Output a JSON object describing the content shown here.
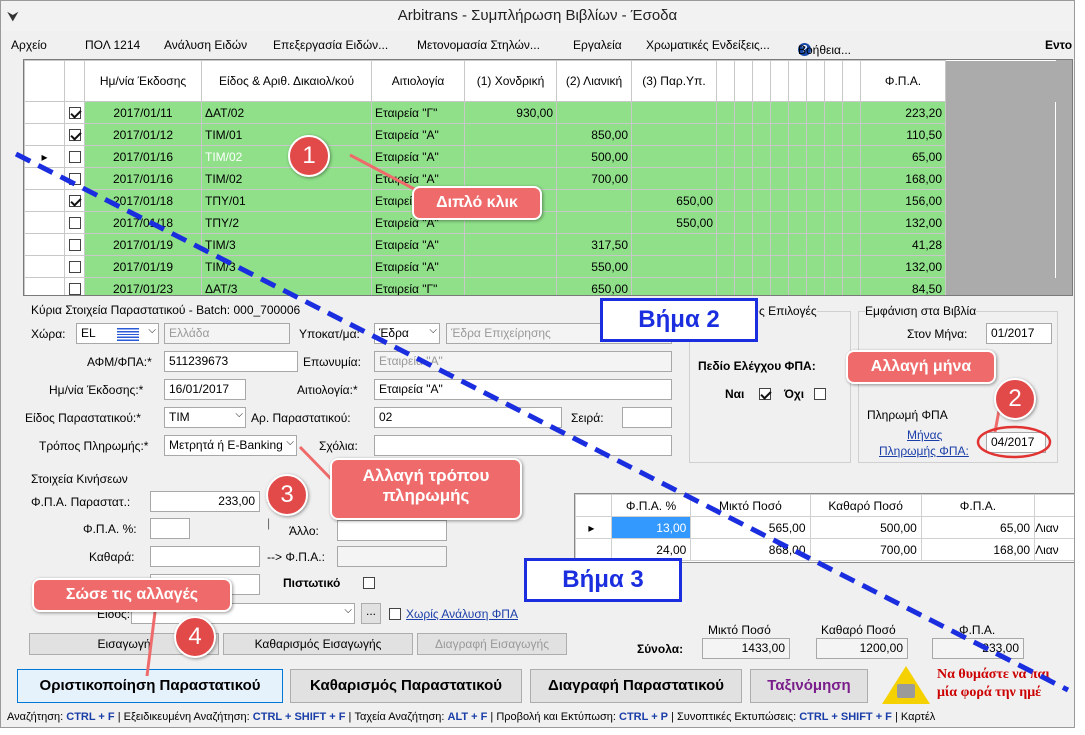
{
  "window": {
    "title": "Arbitrans - Συμπλήρωση Βιβλίων - Έσοδα",
    "icon": "arbitrans-logo-icon"
  },
  "menu": [
    "Αρχείο",
    "ΠΟΛ 1214",
    "Ανάλυση Ειδών",
    "Επεξεργασία Ειδών...",
    "Μετονομασία Στηλών...",
    "Εργαλεία",
    "Χρωματικές Ενδείξεις...",
    "Βοήθεια...",
    "Εντο"
  ],
  "grid": {
    "headers": [
      "Ημ/νία Έκδοσης",
      "Είδος & Αριθ. Δικαιολ/κού",
      "Αιτιολογία",
      "(1) Χονδρική",
      "(2) Λιανική",
      "(3) Παρ.Υπ.",
      "Φ.Π.Α."
    ],
    "rows": [
      {
        "checked": true,
        "date": "2017/01/11",
        "doc": "ΔΑΤ/02",
        "reason": "Εταιρεία \"Γ\"",
        "c1": "930,00",
        "c2": "",
        "c3": "",
        "vat": "223,20"
      },
      {
        "checked": true,
        "date": "2017/01/12",
        "doc": "ΤΙΜ/01",
        "reason": "Εταιρεία \"Α\"",
        "c1": "",
        "c2": "850,00",
        "c3": "",
        "vat": "110,50"
      },
      {
        "checked": false,
        "date": "2017/01/16",
        "doc": "ΤΙΜ/02",
        "reason": "Εταιρεία \"Α\"",
        "c1": "",
        "c2": "500,00",
        "c3": "",
        "vat": "65,00"
      },
      {
        "checked": false,
        "date": "2017/01/16",
        "doc": "ΤΙΜ/02",
        "reason": "Εταιρεία \"Α\"",
        "c1": "",
        "c2": "700,00",
        "c3": "",
        "vat": "168,00"
      },
      {
        "checked": true,
        "date": "2017/01/18",
        "doc": "ΤΠΥ/01",
        "reason": "Εταιρεία \"Α\"",
        "c1": "",
        "c2": "",
        "c3": "650,00",
        "vat": "156,00"
      },
      {
        "checked": false,
        "date": "2017/01/18",
        "doc": "ΤΠΥ/2",
        "reason": "Εταιρεία \"Α\"",
        "c1": "",
        "c2": "",
        "c3": "550,00",
        "vat": "132,00"
      },
      {
        "checked": false,
        "date": "2017/01/19",
        "doc": "ΤΙΜ/3",
        "reason": "Εταιρεία \"Α\"",
        "c1": "",
        "c2": "317,50",
        "c3": "",
        "vat": "41,28"
      },
      {
        "checked": false,
        "date": "2017/01/19",
        "doc": "ΤΙΜ/3",
        "reason": "Εταιρεία \"Α\"",
        "c1": "",
        "c2": "550,00",
        "c3": "",
        "vat": "132,00"
      },
      {
        "checked": false,
        "date": "2017/01/23",
        "doc": "ΔΑΤ/3",
        "reason": "Εταιρεία \"Γ\"",
        "c1": "",
        "c2": "650,00",
        "c3": "",
        "vat": "84,50"
      }
    ]
  },
  "main": {
    "title": "Κύρια Στοιχεία Παραστατικού - Batch: 000_700006",
    "country_label": "Χώρα:",
    "country_code": "EL",
    "country_name": "Ελλάδα",
    "branch_label": "Υποκατ/μα:",
    "branch_value": "Έδρα",
    "branch_name": "Έδρα Επιχείρησης",
    "afm_label": "ΑΦΜ/ΦΠΑ:*",
    "afm_value": "511239673",
    "name_label": "Επωνυμία:",
    "name_value": "Εταιρεία \"Α\"",
    "date_label": "Ημ/νία Έκδοσης:*",
    "date_value": "16/01/2017",
    "reason_label": "Αιτιολογία:*",
    "reason_value": "Εταιρεία \"Α\"",
    "type_label": "Είδος Παραστατικού:*",
    "type_value": "ΤΙΜ",
    "num_label": "Αρ. Παραστατικού:",
    "num_value": "02",
    "series_label": "Σειρά:",
    "series_value": "",
    "pay_label": "Τρόπος Πληρωμής:*",
    "pay_value": "Μετρητά ή E-Banking",
    "notes_label": "Σχόλια:",
    "notes_value": ""
  },
  "options": {
    "title": "ς Επιλογές",
    "vat_check_label": "Πεδίο Ελέγχου ΦΠΑ:",
    "yes": "Ναι",
    "no": "Όχι",
    "yes_checked": true,
    "no_checked": false
  },
  "books": {
    "title": "Εμφάνιση στα Βιβλία",
    "month_label": "Στον Μήνα:",
    "month_value": "01/2017",
    "vat_title": "Πληρωμή ΦΠΑ",
    "vat_link1": "Μήνας",
    "vat_link2": "Πληρωμής ΦΠΑ:",
    "vat_month": "04/2017"
  },
  "moves": {
    "title": "Στοιχεία Κινήσεων",
    "vat_doc_label": "Φ.Π.Α. Παραστατ.:",
    "vat_doc_value": "233,00",
    "e_mark": "€",
    "vat_pct_label": "Φ.Π.Α. %:",
    "net_label": "Καθαρά:",
    "other_label": "Άλλο:",
    "arrow_vat_label": "--> Φ.Π.Α.:",
    "credit_label": "Πιστωτικό",
    "item_label": "Είδος:",
    "no_analysis": "Χωρίς Ανάλυση ΦΠΑ",
    "btn_insert": "Εισαγωγή",
    "btn_clear_insert": "Καθαρισμός Εισαγωγής",
    "btn_delete_insert": "Διαγραφή Εισαγωγής"
  },
  "vat_grid": {
    "headers": [
      "Φ.Π.Α. %",
      "Μικτό Ποσό",
      "Καθαρό Ποσό",
      "Φ.Π.Α."
    ],
    "rows": [
      [
        "13,00",
        "565,00",
        "500,00",
        "65,00",
        "Λιαν"
      ],
      [
        "24,00",
        "868,00",
        "700,00",
        "168,00",
        "Λιαν"
      ]
    ]
  },
  "totals": {
    "label": "Σύνολα:",
    "h1": "Μικτό Ποσό",
    "h2": "Καθαρό Ποσό",
    "h3": "Φ.Π.Α.",
    "v1": "1433,00",
    "v2": "1200,00",
    "v3": "233,00"
  },
  "actions": {
    "finalize": "Οριστικοποίηση Παραστατικού",
    "clear": "Καθαρισμός Παραστατικού",
    "delete": "Διαγραφή Παραστατικού",
    "sort": "Ταξινόμηση"
  },
  "reminder": {
    "line1": "Να θυμάστε να παι",
    "line2": "μία φορά την ημέ"
  },
  "statusbar": [
    [
      "Αναζήτηση: ",
      "CTRL + F"
    ],
    [
      "  |  Εξειδικευμένη Αναζήτηση: ",
      "CTRL + SHIFT + F"
    ],
    [
      "  |  Ταχεία Αναζήτηση: ",
      "ALT + F"
    ],
    [
      "  |  Προβολή και Εκτύπωση: ",
      "CTRL + P"
    ],
    [
      "  |  Συνοπτικές Εκτυπώσεις: ",
      "CTRL + SHIFT + F"
    ],
    [
      "  |  Καρτέλ",
      ""
    ]
  ],
  "annotations": {
    "n1": "1",
    "n2": "2",
    "n3": "3",
    "n4": "4",
    "double_click": "Διπλό κλικ",
    "change_month": "Αλλαγή μήνα",
    "change_pay_1": "Αλλαγή τρόπου",
    "change_pay_2": "πληρωμής",
    "save": "Σώσε τις αλλαγές",
    "step2": "Βήμα 2",
    "step3": "Βήμα 3"
  },
  "colors": {
    "row_green": "#8fe089",
    "selection": "#3399ff",
    "callout": "#ef6b6b",
    "step_blue": "#1a2ee0",
    "link": "#1a3ea8"
  }
}
